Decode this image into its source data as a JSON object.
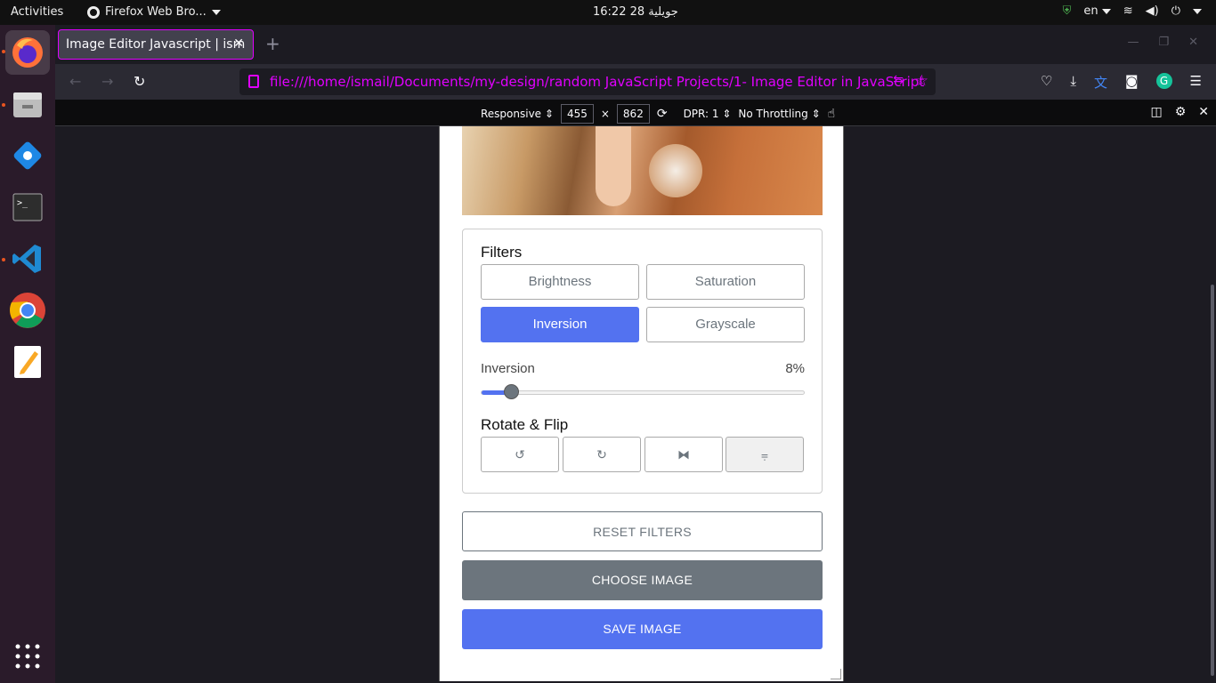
{
  "system": {
    "activities": "Activities",
    "app_menu": "Firefox Web Bro...",
    "clock": "16:22  28 جويلية",
    "lang": "en"
  },
  "browser": {
    "tab_title": "Image Editor Javascript | ism",
    "url": "file:///home/ismail/Documents/my-design/random JavaScript Projects/1- Image Editor in JavaScript",
    "rdm": {
      "device": "Responsive",
      "width": "455",
      "times": "×",
      "height": "862",
      "dpr": "DPR: 1",
      "throttling": "No Throttling"
    }
  },
  "editor": {
    "filters_title": "Filters",
    "filters": [
      {
        "label": "Brightness",
        "active": false
      },
      {
        "label": "Saturation",
        "active": false
      },
      {
        "label": "Inversion",
        "active": true
      },
      {
        "label": "Grayscale",
        "active": false
      }
    ],
    "slider": {
      "name": "Inversion",
      "value_text": "8%",
      "value": 8
    },
    "rotate_title": "Rotate & Flip",
    "rotate_buttons": [
      {
        "icon": "rotate-left-icon",
        "glyph": "↺"
      },
      {
        "icon": "rotate-right-icon",
        "glyph": "↻"
      },
      {
        "icon": "flip-horizontal-icon",
        "glyph": "⧓"
      },
      {
        "icon": "flip-vertical-icon",
        "glyph": "⩦"
      }
    ],
    "reset_label": "RESET FILTERS",
    "choose_label": "CHOOSE IMAGE",
    "save_label": "SAVE IMAGE"
  },
  "colors": {
    "accent": "#5372f0",
    "secondary": "#6c757d",
    "firefox_private": "#e100ff"
  }
}
